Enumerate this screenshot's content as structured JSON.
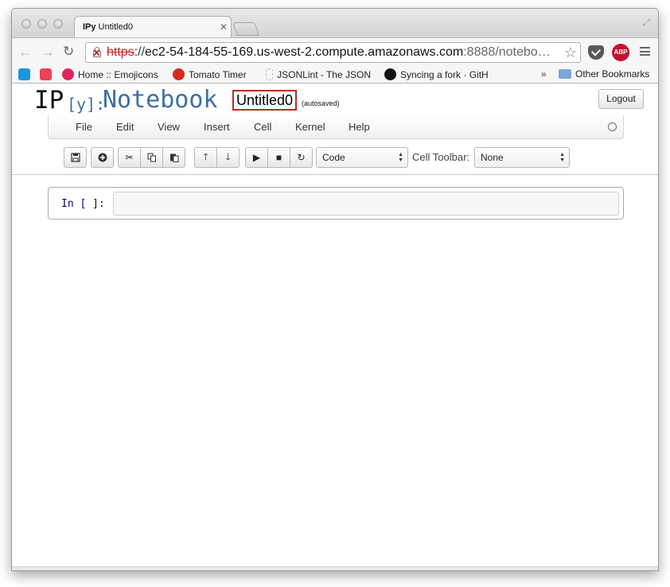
{
  "browser": {
    "tab": {
      "favicon": "IPy",
      "title": "Untitled0",
      "close_icon": "close-icon"
    },
    "url": {
      "scheme": "https",
      "separator": "://",
      "host": "ec2-54-184-55-169.us-west-2.compute.amazonaws.com",
      "rest": ":8888/notebo…"
    },
    "bookmarks": [
      {
        "label": "",
        "icon": "twitter-icon"
      },
      {
        "label": "",
        "icon": "pocket-icon"
      },
      {
        "label": "Home :: Emojicons",
        "icon": "emojicons-icon"
      },
      {
        "label": "Tomato Timer",
        "icon": "tomato-icon"
      },
      {
        "label": "JSONLint - The JSON",
        "icon": "jsonlint-icon"
      },
      {
        "label": "Syncing a fork · GitH",
        "icon": "github-icon"
      }
    ],
    "bookmarks_overflow": "»",
    "other_bookmarks": "Other Bookmarks",
    "extensions": {
      "abp_label": "ABP"
    }
  },
  "notebook": {
    "logo": {
      "ip": "IP",
      "y": "[y]:",
      "notebook": "Notebook"
    },
    "name": "Untitled0",
    "save_status": "(autosaved)",
    "logout_label": "Logout",
    "menu": [
      "File",
      "Edit",
      "View",
      "Insert",
      "Cell",
      "Kernel",
      "Help"
    ],
    "toolbar": {
      "cell_type": "Code",
      "cell_toolbar_label": "Cell Toolbar:",
      "cell_toolbar_value": "None"
    },
    "cells": [
      {
        "prompt": "In [ ]:",
        "source": ""
      }
    ]
  }
}
